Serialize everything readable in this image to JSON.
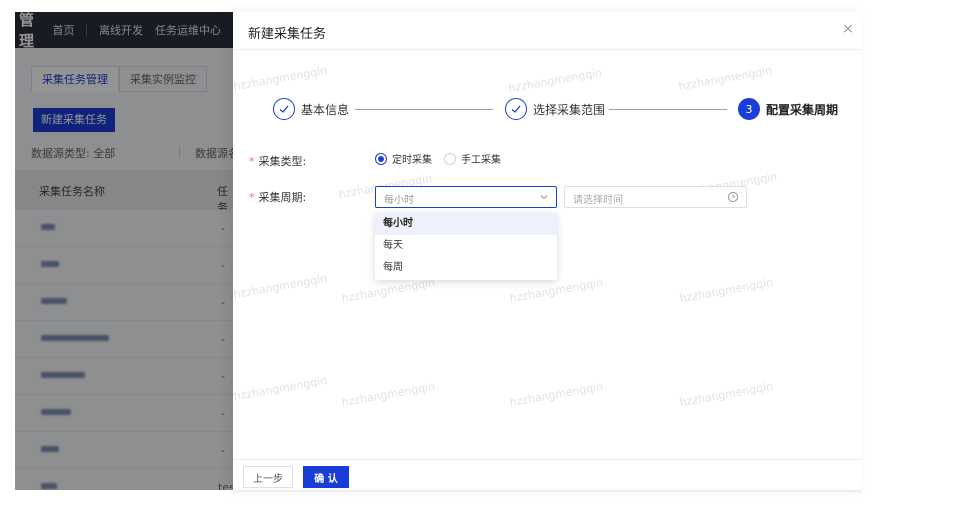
{
  "background": {
    "brand": "管理",
    "nav": [
      "首页",
      "离线开发",
      "任务运维中心"
    ],
    "tabs": [
      "采集任务管理",
      "采集实例监控"
    ],
    "new_button": "新建采集任务",
    "filter_type": "数据源类型: 全部",
    "filter_name": "数据源名",
    "table_head": [
      "采集任务名称",
      "任务"
    ],
    "last_row_partial": "tes"
  },
  "drawer": {
    "title": "新建采集任务",
    "close": "×",
    "watermark": "hzzhangmengqin",
    "steps": [
      {
        "label": "基本信息",
        "status": "done"
      },
      {
        "label": "选择采集范围",
        "status": "done"
      },
      {
        "label": "配置采集周期",
        "status": "active",
        "number": "3"
      }
    ],
    "form": {
      "collect_type_label": "采集类型:",
      "collect_type_options": [
        "定时采集",
        "手工采集"
      ],
      "collect_type_selected": "定时采集",
      "cycle_label": "采集周期:",
      "cycle_value": "每小时",
      "time_placeholder": "请选择时间",
      "cycle_options": [
        "每小时",
        "每天",
        "每周"
      ]
    },
    "footer": {
      "prev": "上一步",
      "confirm": "确 认"
    }
  },
  "colors": {
    "primary": "#1a3dd8",
    "required": "#f56c6c"
  }
}
